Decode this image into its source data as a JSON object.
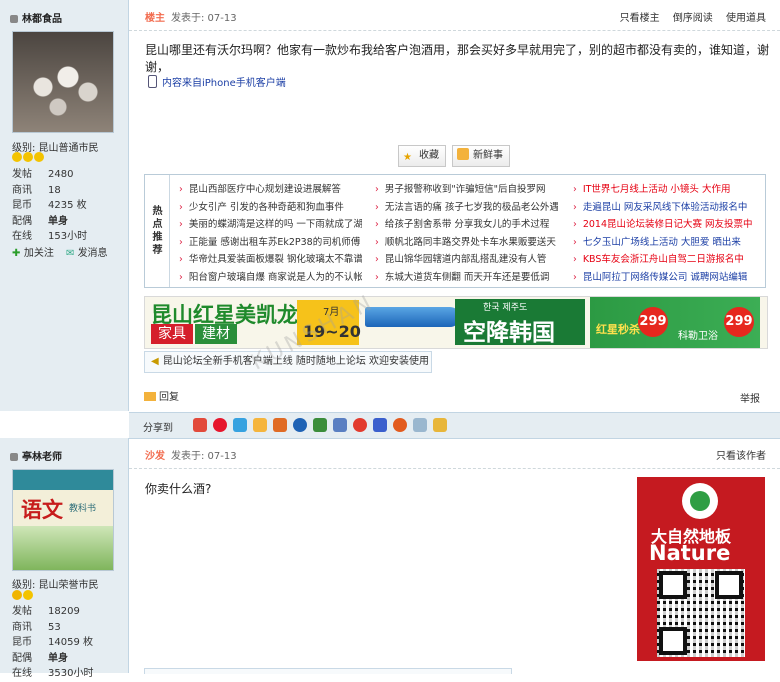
{
  "post1": {
    "user": {
      "name": "林都食品",
      "level": "级别: 昆山普通市民",
      "stats": [
        {
          "k": "发帖",
          "v": "2480"
        },
        {
          "k": "商讯",
          "v": "18"
        },
        {
          "k": "昆币",
          "v": "4235 枚"
        },
        {
          "k": "配偶",
          "v": "单身"
        },
        {
          "k": "在线",
          "v": "153小时"
        }
      ],
      "follow": "加关注",
      "message": "发消息"
    },
    "role": "楼主",
    "time": "发表于: 07-13",
    "toplinks": [
      "只看楼主",
      "倒序阅读",
      "使用道具"
    ],
    "content": "昆山哪里还有沃尔玛啊？他家有一款炒布我给客户泡酒用，那会买好多早就用完了，别的超市都没有卖的，谁知道，谢谢，",
    "client_note": "内容来自iPhone手机客户端",
    "buttons": {
      "favorite": "收藏",
      "fresh": "新鲜事"
    },
    "hot_label": "热点推荐",
    "hot_col1": [
      "昆山西部医疗中心规划建设进展解答",
      "少女引产 引发的各种奇葩和狗血事件",
      "美丽的蝶湖湾是这样的吗 一下雨就成了湖",
      "正能量 感谢出租车苏Ek2P38的司机师傅",
      "华帝灶具爱装面板爆裂 钢化玻璃太不靠谱",
      "阳台窗户玻璃自爆 商家说是人为的不认帐"
    ],
    "hot_col2": [
      "男子报警称收到\"诈骗短信\"后自投罗网",
      "无法言语的痛 孩子七岁我的极品老公外遇",
      "给孩子割舍系带 分享我女儿的手术过程",
      "顺帆北路同丰路交界处卡车水果贩要送天",
      "昆山锦华园辖道内部乱搭乱建没有人管",
      "东城大道货车侧翻 而天开车还是要低调"
    ],
    "hot_col3": [
      "IT世界七月线上活动 小镜头 大作用",
      "走遍昆山 网友采风线下体验活动报名中",
      "2014昆山论坛装修日记大赛 网友投票中",
      "七夕玉山广场线上活动 大胆爱 晒出来",
      "KBS车友会浙江舟山自驾二日游报名中",
      "昆山阿拉丁网络传媒公司 诚聘网站编辑"
    ],
    "banner": {
      "brand": "昆山红星美凯龙",
      "tag1": "家具",
      "tag2": "建材",
      "month": "7月",
      "days": "19~20",
      "korea_small": "한국 제주도",
      "korea": "空降韩国",
      "promo": "红星秒杀",
      "price1": "299",
      "bath": "科勒卫浴",
      "price2": "299"
    },
    "notice": "昆山论坛全新手机客户端上线 随时随地上论坛 欢迎安装使用",
    "reply": "回复",
    "report": "举报"
  },
  "share_label": "分享到",
  "post2": {
    "user": {
      "name": "亭林老师",
      "level": "级别: 昆山荣誉市民",
      "stats": [
        {
          "k": "发帖",
          "v": "18209"
        },
        {
          "k": "商讯",
          "v": "53"
        },
        {
          "k": "昆币",
          "v": "14059 枚"
        },
        {
          "k": "配偶",
          "v": "单身"
        },
        {
          "k": "在线",
          "v": "3530小时"
        }
      ],
      "avatar_title": "语文",
      "avatar_sub": "教科书"
    },
    "role": "沙发",
    "time": "发表于: 07-13",
    "toplinks": [
      "只看该作者"
    ],
    "content": "你卖什么酒?",
    "ad": {
      "cn": "大自然地板",
      "en": "Nature"
    }
  },
  "watermark": "KUNSHAN",
  "colors": {
    "accent": "#f26c4f",
    "sidebar": "#e5edf2",
    "red_link": "#e60012",
    "blue_link": "#1c3fa5"
  }
}
